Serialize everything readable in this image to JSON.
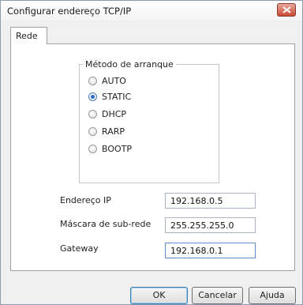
{
  "window": {
    "title": "Configurar endereço TCP/IP"
  },
  "tabs": [
    {
      "label": "Rede"
    }
  ],
  "boot_method": {
    "group_label": "Método de arranque",
    "options": [
      {
        "label": "AUTO",
        "checked": false
      },
      {
        "label": "STATIC",
        "checked": true
      },
      {
        "label": "DHCP",
        "checked": false
      },
      {
        "label": "RARP",
        "checked": false
      },
      {
        "label": "BOOTP",
        "checked": false
      }
    ]
  },
  "fields": {
    "ip": {
      "label": "Endereço IP",
      "value": "192.168.0.5"
    },
    "subnet": {
      "label": "Máscara de sub-rede",
      "value": "255.255.255.0"
    },
    "gateway": {
      "label": "Gateway",
      "value": "192.168.0.1"
    }
  },
  "buttons": {
    "ok": "OK",
    "cancel": "Cancelar",
    "help": "Ajuda"
  }
}
